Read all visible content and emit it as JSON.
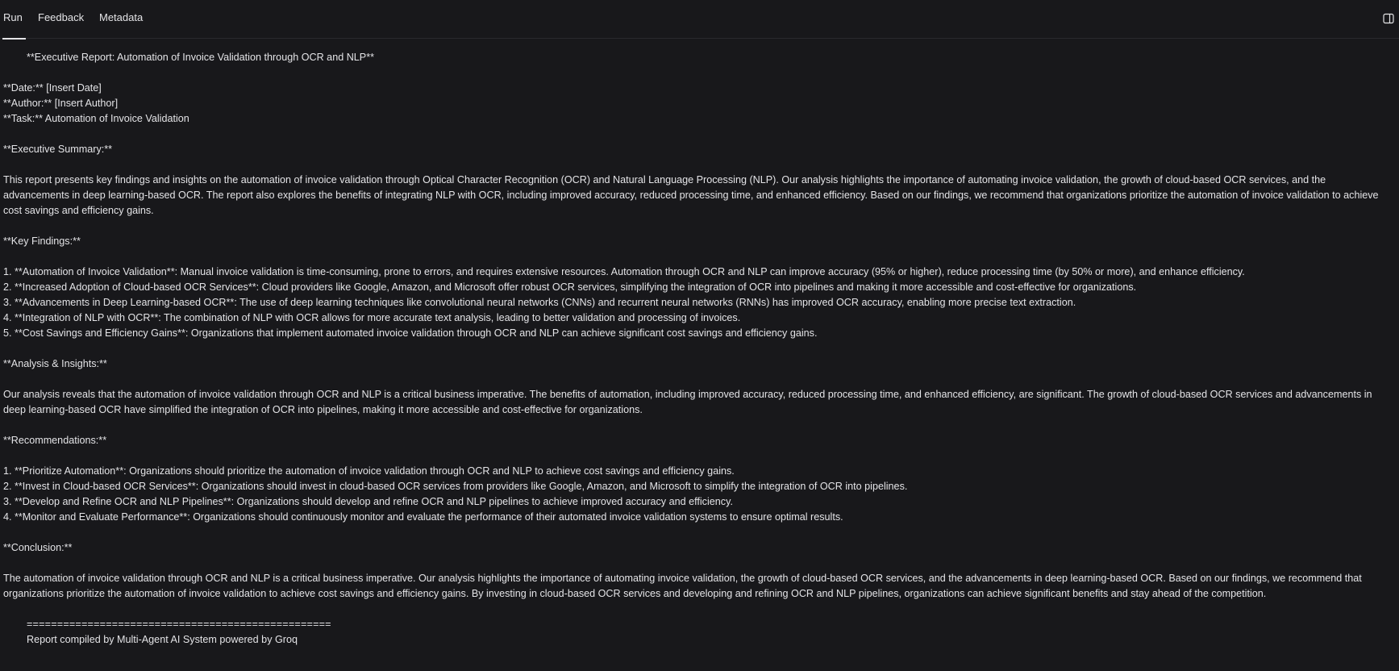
{
  "tabs": {
    "run": "Run",
    "feedback": "Feedback",
    "metadata": "Metadata"
  },
  "report": {
    "title": "**Executive Report: Automation of Invoice Validation through OCR and NLP**",
    "date": "**Date:** [Insert Date]",
    "author": "**Author:** [Insert Author]",
    "task": "**Task:** Automation of Invoice Validation",
    "exec_summary_heading": "**Executive Summary:**",
    "exec_summary": "This report presents key findings and insights on the automation of invoice validation through Optical Character Recognition (OCR) and Natural Language Processing (NLP). Our analysis highlights the importance of automating invoice validation, the growth of cloud-based OCR services, and the advancements in deep learning-based OCR. The report also explores the benefits of integrating NLP with OCR, including improved accuracy, reduced processing time, and enhanced efficiency. Based on our findings, we recommend that organizations prioritize the automation of invoice validation to achieve cost savings and efficiency gains.",
    "key_findings_heading": "**Key Findings:**",
    "key_findings": [
      "1. **Automation of Invoice Validation**: Manual invoice validation is time-consuming, prone to errors, and requires extensive resources. Automation through OCR and NLP can improve accuracy (95% or higher), reduce processing time (by 50% or more), and enhance efficiency.",
      "2. **Increased Adoption of Cloud-based OCR Services**: Cloud providers like Google, Amazon, and Microsoft offer robust OCR services, simplifying the integration of OCR into pipelines and making it more accessible and cost-effective for organizations.",
      "3. **Advancements in Deep Learning-based OCR**: The use of deep learning techniques like convolutional neural networks (CNNs) and recurrent neural networks (RNNs) has improved OCR accuracy, enabling more precise text extraction.",
      "4. **Integration of NLP with OCR**: The combination of NLP with OCR allows for more accurate text analysis, leading to better validation and processing of invoices.",
      "5. **Cost Savings and Efficiency Gains**: Organizations that implement automated invoice validation through OCR and NLP can achieve significant cost savings and efficiency gains."
    ],
    "analysis_heading": "**Analysis & Insights:**",
    "analysis": "Our analysis reveals that the automation of invoice validation through OCR and NLP is a critical business imperative. The benefits of automation, including improved accuracy, reduced processing time, and enhanced efficiency, are significant. The growth of cloud-based OCR services and advancements in deep learning-based OCR have simplified the integration of OCR into pipelines, making it more accessible and cost-effective for organizations.",
    "recommendations_heading": "**Recommendations:**",
    "recommendations": [
      "1. **Prioritize Automation**: Organizations should prioritize the automation of invoice validation through OCR and NLP to achieve cost savings and efficiency gains.",
      "2. **Invest in Cloud-based OCR Services**: Organizations should invest in cloud-based OCR services from providers like Google, Amazon, and Microsoft to simplify the integration of OCR into pipelines.",
      "3. **Develop and Refine OCR and NLP Pipelines**: Organizations should develop and refine OCR and NLP pipelines to achieve improved accuracy and efficiency.",
      "4. **Monitor and Evaluate Performance**: Organizations should continuously monitor and evaluate the performance of their automated invoice validation systems to ensure optimal results."
    ],
    "conclusion_heading": "**Conclusion:**",
    "conclusion": "The automation of invoice validation through OCR and NLP is a critical business imperative. Our analysis highlights the importance of automating invoice validation, the growth of cloud-based OCR services, and the advancements in deep learning-based OCR. Based on our findings, we recommend that organizations prioritize the automation of invoice validation to achieve cost savings and efficiency gains. By investing in cloud-based OCR services and developing and refining OCR and NLP pipelines, organizations can achieve significant benefits and stay ahead of the competition.",
    "separator": "==================================================",
    "footer": "Report compiled by Multi-Agent AI System powered by Groq"
  }
}
